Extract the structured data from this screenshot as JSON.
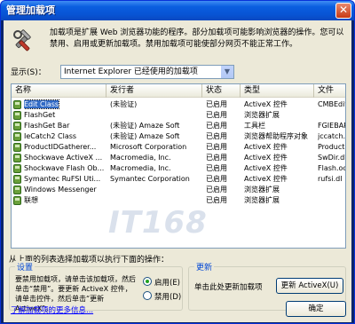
{
  "window": {
    "title": "管理加载项",
    "close_glyph": "✕"
  },
  "intro_text": "加载项是扩展 Web 浏览器功能的程序。部分加载项可能影响浏览器的操作。您可以禁用、启用或更新加载项。禁用加载项可能使部分网页不能正常工作。",
  "show": {
    "label": "显示(S)：",
    "selected": "Internet Explorer 已经使用的加载项"
  },
  "table": {
    "columns": [
      "名称",
      "发行者",
      "状态",
      "类型",
      "文件"
    ],
    "rows": [
      [
        "Edit Class",
        "(未验证)",
        "已启用",
        "ActiveX 控件",
        "CMBEdit."
      ],
      [
        "FlashGet",
        "",
        "已启用",
        "浏览器扩展",
        ""
      ],
      [
        "FlashGet Bar",
        "(未验证) Amaze Soft",
        "已启用",
        "工具栏",
        "FGIEBAR."
      ],
      [
        "IeCatch2 Class",
        "(未验证) Amaze Soft",
        "已启用",
        "浏览器帮助程序对象",
        "jccatch."
      ],
      [
        "ProductIDGatherer...",
        "Microsoft Corporation",
        "已启用",
        "ActiveX 控件",
        "ProductI"
      ],
      [
        "Shockwave ActiveX ...",
        "Macromedia, Inc.",
        "已启用",
        "ActiveX 控件",
        "SwDir.dl"
      ],
      [
        "Shockwave Flash Ob...",
        "Macromedia, Inc.",
        "已启用",
        "ActiveX 控件",
        "Flash.oc"
      ],
      [
        "Symantec RuFSI Uti...",
        "Symantec Corporation",
        "已启用",
        "ActiveX 控件",
        "rufsi.dl"
      ],
      [
        "Windows Messenger",
        "",
        "已启用",
        "浏览器扩展",
        ""
      ],
      [
        "联想",
        "",
        "已启用",
        "浏览器扩展",
        ""
      ]
    ]
  },
  "action_label": "从上面的列表选择加载项以执行下面的操作：",
  "settings": {
    "title": "设置",
    "text": "要禁用加载项，请单击该加载项，然后单击“禁用”。要更新 ActiveX 控件，请单击控件，然后单击“更新 ActiveX”。",
    "enable_label": "启用(E)",
    "disable_label": "禁用(D)"
  },
  "update": {
    "title": "更新",
    "text": "单击此处更新加载项",
    "button_label": "更新 ActiveX(U)"
  },
  "footer_link": "了解加载项的更多信息...",
  "ok_label": "确定",
  "watermark": "IT168"
}
